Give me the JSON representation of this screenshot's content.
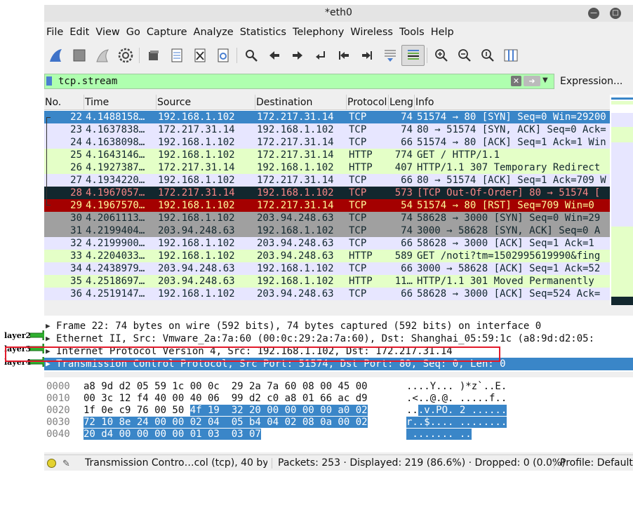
{
  "annotations": [
    "layer2",
    "layer3",
    "layer4"
  ],
  "window": {
    "title": "*eth0"
  },
  "menu": [
    "File",
    "Edit",
    "View",
    "Go",
    "Capture",
    "Analyze",
    "Statistics",
    "Telephony",
    "Wireless",
    "Tools",
    "Help"
  ],
  "toolbar": [
    "shark-fin-icon",
    "stop-square-icon",
    "restart-fin-icon",
    "options-gear-icon",
    "open-folder-icon",
    "save-file-icon",
    "close-file-icon",
    "reload-icon",
    "find-icon",
    "go-back-icon",
    "go-forward-icon",
    "go-to-packet-icon",
    "first-packet-icon",
    "last-packet-icon",
    "autoscroll-icon",
    "colorize-icon",
    "zoom-in-icon",
    "zoom-out-icon",
    "normal-size-icon",
    "resize-columns-icon"
  ],
  "filter": {
    "value": "tcp.stream",
    "expression_label": "Expression..."
  },
  "columns": [
    "No.",
    "Time",
    "Source",
    "Destination",
    "Protocol",
    "Leng",
    "Info"
  ],
  "packets": [
    {
      "no": "22",
      "time": "4.1488158…",
      "src": "192.168.1.102",
      "dst": "172.217.31.14",
      "proto": "TCP",
      "len": "74",
      "info": "51574 → 80 [SYN] Seq=0 Win=29200",
      "style": "selected"
    },
    {
      "no": "23",
      "time": "4.1637838…",
      "src": "172.217.31.14",
      "dst": "192.168.1.102",
      "proto": "TCP",
      "len": "74",
      "info": "80 → 51574 [SYN, ACK] Seq=0 Ack=",
      "style": "tcp"
    },
    {
      "no": "24",
      "time": "4.1638098…",
      "src": "192.168.1.102",
      "dst": "172.217.31.14",
      "proto": "TCP",
      "len": "66",
      "info": "51574 → 80 [ACK] Seq=1 Ack=1 Win",
      "style": "tcp"
    },
    {
      "no": "25",
      "time": "4.1643146…",
      "src": "192.168.1.102",
      "dst": "172.217.31.14",
      "proto": "HTTP",
      "len": "774",
      "info": "GET / HTTP/1.1",
      "style": "http"
    },
    {
      "no": "26",
      "time": "4.1927387…",
      "src": "172.217.31.14",
      "dst": "192.168.1.102",
      "proto": "HTTP",
      "len": "407",
      "info": "HTTP/1.1 307 Temporary Redirect",
      "style": "http"
    },
    {
      "no": "27",
      "time": "4.1934220…",
      "src": "192.168.1.102",
      "dst": "172.217.31.14",
      "proto": "TCP",
      "len": "66",
      "info": "80 → 51574 [ACK] Seq=1 Ack=709 W",
      "style": "tcp"
    },
    {
      "no": "28",
      "time": "4.1967057…",
      "src": "172.217.31.14",
      "dst": "192.168.1.102",
      "proto": "TCP",
      "len": "573",
      "info": "[TCP Out-Of-Order] 80 → 51574 [",
      "style": "badtcp"
    },
    {
      "no": "29",
      "time": "4.1967570…",
      "src": "192.168.1.102",
      "dst": "172.217.31.14",
      "proto": "TCP",
      "len": "54",
      "info": "51574 → 80 [RST] Seq=709 Win=0",
      "style": "rst"
    },
    {
      "no": "30",
      "time": "4.2061113…",
      "src": "192.168.1.102",
      "dst": "203.94.248.63",
      "proto": "TCP",
      "len": "74",
      "info": "58628 → 3000 [SYN] Seq=0 Win=29",
      "style": "syn"
    },
    {
      "no": "31",
      "time": "4.2199404…",
      "src": "203.94.248.63",
      "dst": "192.168.1.102",
      "proto": "TCP",
      "len": "74",
      "info": "3000 → 58628 [SYN, ACK] Seq=0 A",
      "style": "syn"
    },
    {
      "no": "32",
      "time": "4.2199900…",
      "src": "192.168.1.102",
      "dst": "203.94.248.63",
      "proto": "TCP",
      "len": "66",
      "info": "58628 → 3000 [ACK] Seq=1 Ack=1",
      "style": "tcp2"
    },
    {
      "no": "33",
      "time": "4.2204033…",
      "src": "192.168.1.102",
      "dst": "203.94.248.63",
      "proto": "HTTP",
      "len": "589",
      "info": "GET /noti?tm=1502995619990&fing",
      "style": "http"
    },
    {
      "no": "34",
      "time": "4.2438979…",
      "src": "203.94.248.63",
      "dst": "192.168.1.102",
      "proto": "TCP",
      "len": "66",
      "info": "3000 → 58628 [ACK] Seq=1 Ack=52",
      "style": "tcp2"
    },
    {
      "no": "35",
      "time": "4.2518697…",
      "src": "203.94.248.63",
      "dst": "192.168.1.102",
      "proto": "HTTP",
      "len": "11…",
      "info": "HTTP/1.1 301 Moved Permanently",
      "style": "http"
    },
    {
      "no": "36",
      "time": "4.2519147…",
      "src": "192.168.1.102",
      "dst": "203.94.248.63",
      "proto": "TCP",
      "len": "66",
      "info": "58628 → 3000 [ACK] Seq=524 Ack=",
      "style": "tcp2"
    }
  ],
  "row_colors": {
    "selected": {
      "bg": "#3a86c8",
      "fg": "#ffffff"
    },
    "tcp": {
      "bg": "#e7e6ff",
      "fg": "#12272e"
    },
    "tcp2": {
      "bg": "#e7e6ff",
      "fg": "#12272e"
    },
    "http": {
      "bg": "#e4ffc7",
      "fg": "#12272e"
    },
    "badtcp": {
      "bg": "#12272e",
      "fg": "#f78787"
    },
    "rst": {
      "bg": "#a40000",
      "fg": "#fffc9c"
    },
    "syn": {
      "bg": "#a0a0a0",
      "fg": "#12272e"
    }
  },
  "details": [
    {
      "text": "Frame 22: 74 bytes on wire (592 bits), 74 bytes captured (592 bits) on interface 0",
      "selected": false
    },
    {
      "text": "Ethernet II, Src: Vmware_2a:7a:60 (00:0c:29:2a:7a:60), Dst: Shanghai_05:59:1c (a8:9d:d2:05:",
      "selected": false
    },
    {
      "text": "Internet Protocol Version 4, Src: 192.168.1.102, Dst: 172.217.31.14",
      "selected": false
    },
    {
      "text": "Transmission Control Protocol, Src Port: 51574, Dst Port: 80, Seq: 0, Len: 0",
      "selected": true
    }
  ],
  "bytes": [
    {
      "offset": "0000",
      "hex": "a8 9d d2 05 59 1c 00 0c  29 2a 7a 60 08 00 45 00",
      "hl_from": 99,
      "ascii": "....Y... )*z`..E.",
      "ascii_hl_from": 99
    },
    {
      "offset": "0010",
      "hex": "00 3c 12 f4 40 00 40 06  99 d2 c0 a8 01 66 ac d9",
      "hl_from": 99,
      "ascii": ".<..@.@. .....f..",
      "ascii_hl_from": 99
    },
    {
      "offset": "0020",
      "hex": "1f 0e c9 76 00 50 4f 19  32 20 00 00 00 00 a0 02",
      "hl_from": 6,
      "ascii": "...v.PO. 2 ......",
      "ascii_hl_from": 2
    },
    {
      "offset": "0030",
      "hex": "72 10 8e 24 00 00 02 04  05 b4 04 02 08 0a 00 02",
      "hl_from": 0,
      "ascii": "r..$.... ........",
      "ascii_hl_from": 0
    },
    {
      "offset": "0040",
      "hex": "20 d4 00 00 00 00 01 03  03 07",
      "hl_from": 0,
      "ascii": " ....... ..",
      "ascii_hl_from": 0
    }
  ],
  "status": {
    "field": "Transmission Contro…col (tcp), 40 byte",
    "packets": "Packets: 253 · Displayed: 219 (86.6%) · Dropped: 0 (0.0%)",
    "profile": "Profile: Default"
  }
}
